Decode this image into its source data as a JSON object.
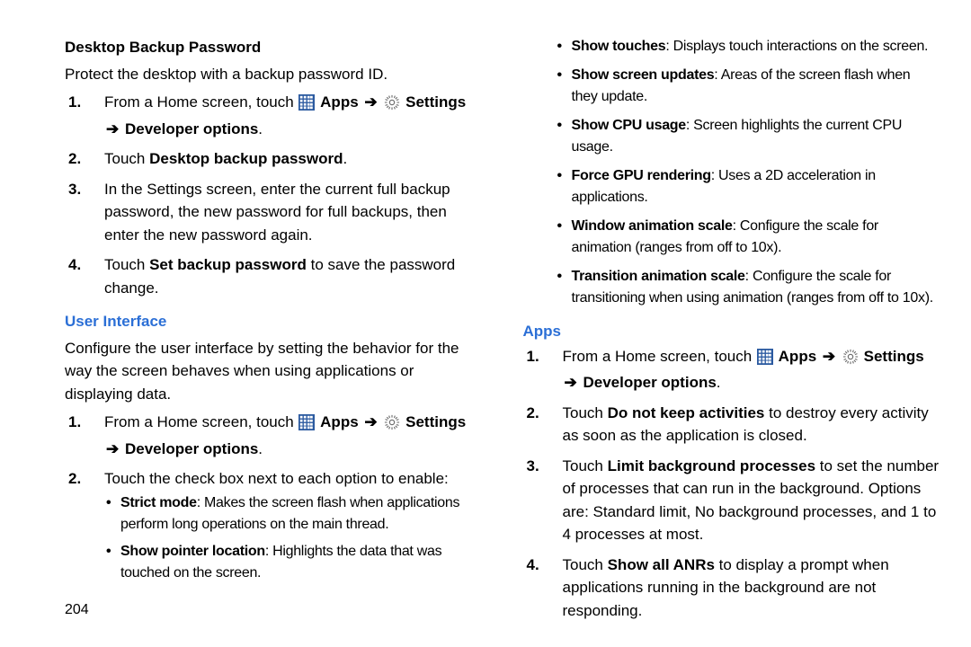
{
  "pageNumber": "204",
  "left": {
    "h1": "Desktop Backup Password",
    "p1": "Protect the desktop with a backup password ID.",
    "steps1": {
      "s1_pre": "From a Home screen, touch ",
      "s1_apps": " Apps ",
      "s1_settings": " Settings ",
      "s1_dev": " Developer options",
      "s2_pre": "Touch ",
      "s2_b": "Desktop backup password",
      "s3": "In the Settings screen, enter the current full backup password, the new password for full backups, then enter the new password again.",
      "s4_pre": "Touch ",
      "s4_b": "Set backup password",
      "s4_post": " to save the password change."
    },
    "h2": "User Interface",
    "p2": "Configure the user interface by setting the behavior for the way the screen behaves when using applications or displaying data.",
    "steps2": {
      "s1_pre": "From a Home screen, touch ",
      "s1_apps": " Apps ",
      "s1_settings": " Settings ",
      "s1_dev": " Developer options",
      "s2": "Touch the check box next to each option to enable:",
      "b1_b": "Strict mode",
      "b1_t": ": Makes the screen flash when applications perform long operations on the main thread.",
      "b2_b": "Show pointer location",
      "b2_t": ": Highlights the data that was touched on the screen."
    }
  },
  "right": {
    "cont_bullets": {
      "b1_b": "Show touches",
      "b1_t": ": Displays touch interactions on the screen.",
      "b2_b": "Show screen updates",
      "b2_t": ": Areas of the screen flash when they update.",
      "b3_b": "Show CPU usage",
      "b3_t": ": Screen highlights the current CPU usage.",
      "b4_b": "Force GPU rendering",
      "b4_t": ": Uses a 2D acceleration in applications.",
      "b5_b": "Window animation scale",
      "b5_t": ": Configure the scale for animation (ranges from off to 10x).",
      "b6_b": "Transition animation scale",
      "b6_t": ": Configure the scale for transitioning when using animation (ranges from off to 10x)."
    },
    "h3": "Apps",
    "steps3": {
      "s1_pre": "From a Home screen, touch ",
      "s1_apps": " Apps ",
      "s1_settings": " Settings ",
      "s1_dev": " Developer options",
      "s2_pre": "Touch ",
      "s2_b": "Do not keep activities",
      "s2_post": " to destroy every activity as soon as the application is closed.",
      "s3_pre": "Touch ",
      "s3_b": "Limit background processes",
      "s3_post": " to set the number of processes that can run in the background. Options are: Standard limit, No background processes, and 1 to 4 processes at most.",
      "s4_pre": "Touch ",
      "s4_b": "Show all ANRs",
      "s4_post": " to display a prompt when applications running in the background are not responding."
    }
  },
  "arrow": "➔",
  "period": "."
}
